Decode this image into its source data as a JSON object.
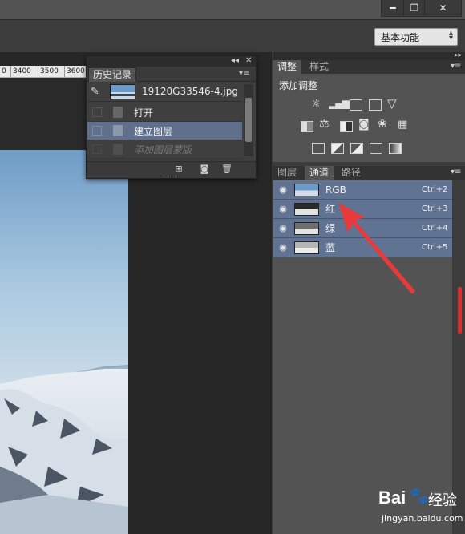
{
  "window": {
    "min_label": "━",
    "restore_label": "❐",
    "close_label": "✕"
  },
  "workspace": {
    "selected": "基本功能",
    "arrow": "▲▼"
  },
  "ruler": {
    "ticks": [
      "0",
      "3400",
      "3500",
      "3600"
    ]
  },
  "history": {
    "tab": "历史记录",
    "snapshot": "19120G33546-4.jpg",
    "items": [
      {
        "label": "打开",
        "state": "normal"
      },
      {
        "label": "建立图层",
        "state": "selected"
      },
      {
        "label": "添加图层蒙版",
        "state": "disabled"
      }
    ]
  },
  "adjustments": {
    "tabs": [
      "调整",
      "样式"
    ],
    "heading": "添加调整"
  },
  "channels": {
    "tabs": [
      "图层",
      "通道",
      "路径"
    ],
    "items": [
      {
        "name": "RGB",
        "shortcut": "Ctrl+2"
      },
      {
        "name": "红",
        "shortcut": "Ctrl+3"
      },
      {
        "name": "绿",
        "shortcut": "Ctrl+4"
      },
      {
        "name": "蓝",
        "shortcut": "Ctrl+5"
      }
    ]
  },
  "watermark": {
    "brand": "Bai",
    "brand_cn": "经验",
    "url": "jingyan.baidu.com"
  },
  "colors": {
    "selected_row": "#617392",
    "annotation_arrow": "#e83a3a",
    "panel_bg": "#535353"
  }
}
